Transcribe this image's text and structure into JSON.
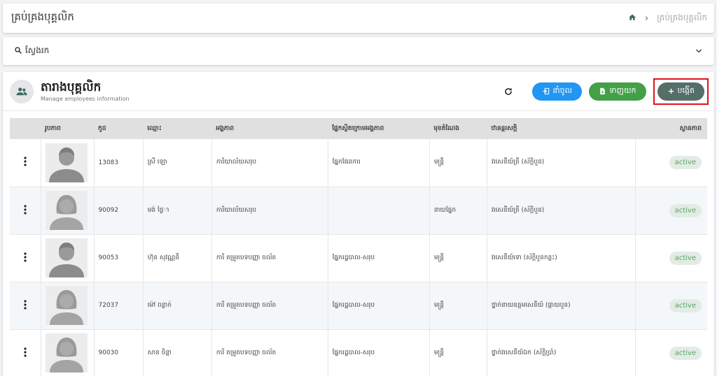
{
  "header": {
    "title": "គ្រប់គ្រងបុគ្គលិក",
    "breadcrumb_current": "គ្រប់គ្រងបុគ្គលិក"
  },
  "search": {
    "label": "ស្វែងរក"
  },
  "panel": {
    "title": "តារាងបុគ្គលិក",
    "subtitle": "Manage employees information",
    "import_label": "នាំចូល",
    "export_label": "ទាញយក",
    "create_label": "បង្កើត"
  },
  "table": {
    "headers": [
      "រូបភាព",
      "កូដ",
      "ឈ្មោះ",
      "អង្គភាព",
      "ផ្នែកស្ថិតក្រោមអង្គភាព",
      "មុខតំណែង",
      "ឋានន្តរសក្តិ",
      "ស្ថានភាព"
    ],
    "rows": [
      {
        "photo": "male",
        "code": "13083",
        "name": "ស្រី ឡោ",
        "unit": "ការិយាល័យសរុប",
        "section": "ផ្នែកផែនការ",
        "position": "មន្ត្រី",
        "rank": "វរសេនីយ៍ត្រី (ស័ក្តិបួន)",
        "status": "active"
      },
      {
        "photo": "female",
        "code": "90092",
        "name": "មង់ ថៃ្ងា",
        "unit": "ការិយាល័យសរុប",
        "section": "",
        "position": "នាយផ្នែក",
        "rank": "វរសេនីយ៍ត្រី (ស័ក្តិបួន)",
        "status": "active"
      },
      {
        "photo": "male",
        "code": "90053",
        "name": "ហ៊ុន សុវណ្ណនី",
        "unit": "ការិ តម្រួតបទបញ្ញា ចល័ត",
        "section": "ផ្នែករដ្ឋបាល-សរុប",
        "position": "មន្ត្រី",
        "rank": "វរសេនីយ៍ទោ (ស័ក្តិបួនកន្លះ)",
        "status": "active"
      },
      {
        "photo": "female",
        "code": "72037",
        "name": "ម៉ៅ ពន្លាក់",
        "unit": "ការិ តម្រួតបទបញ្ញា ចល័ត",
        "section": "ផ្នែករដ្ឋបាល-សរុប",
        "position": "មន្ត្រី",
        "rank": "ថ្នាក់នាយឧត្តមសេនីយ៍ (ផ្កាយបួន)",
        "status": "active"
      },
      {
        "photo": "female",
        "code": "90030",
        "name": "សាន ចិន្តា",
        "unit": "ការិ តម្រួតបទបញ្ញា ចល័ត",
        "section": "ផ្នែករដ្ឋបាល-សរុប",
        "position": "មន្ត្រី",
        "rank": "ថ្នាក់វរសេនីយ៍ឯក (ស័ក្តិប្រាំ)",
        "status": "active"
      }
    ]
  },
  "colors": {
    "import_button": "#2196f3",
    "export_button": "#43a047",
    "create_button": "#546e68",
    "highlight_border": "#e0111b",
    "status_active_text": "#51a862"
  }
}
